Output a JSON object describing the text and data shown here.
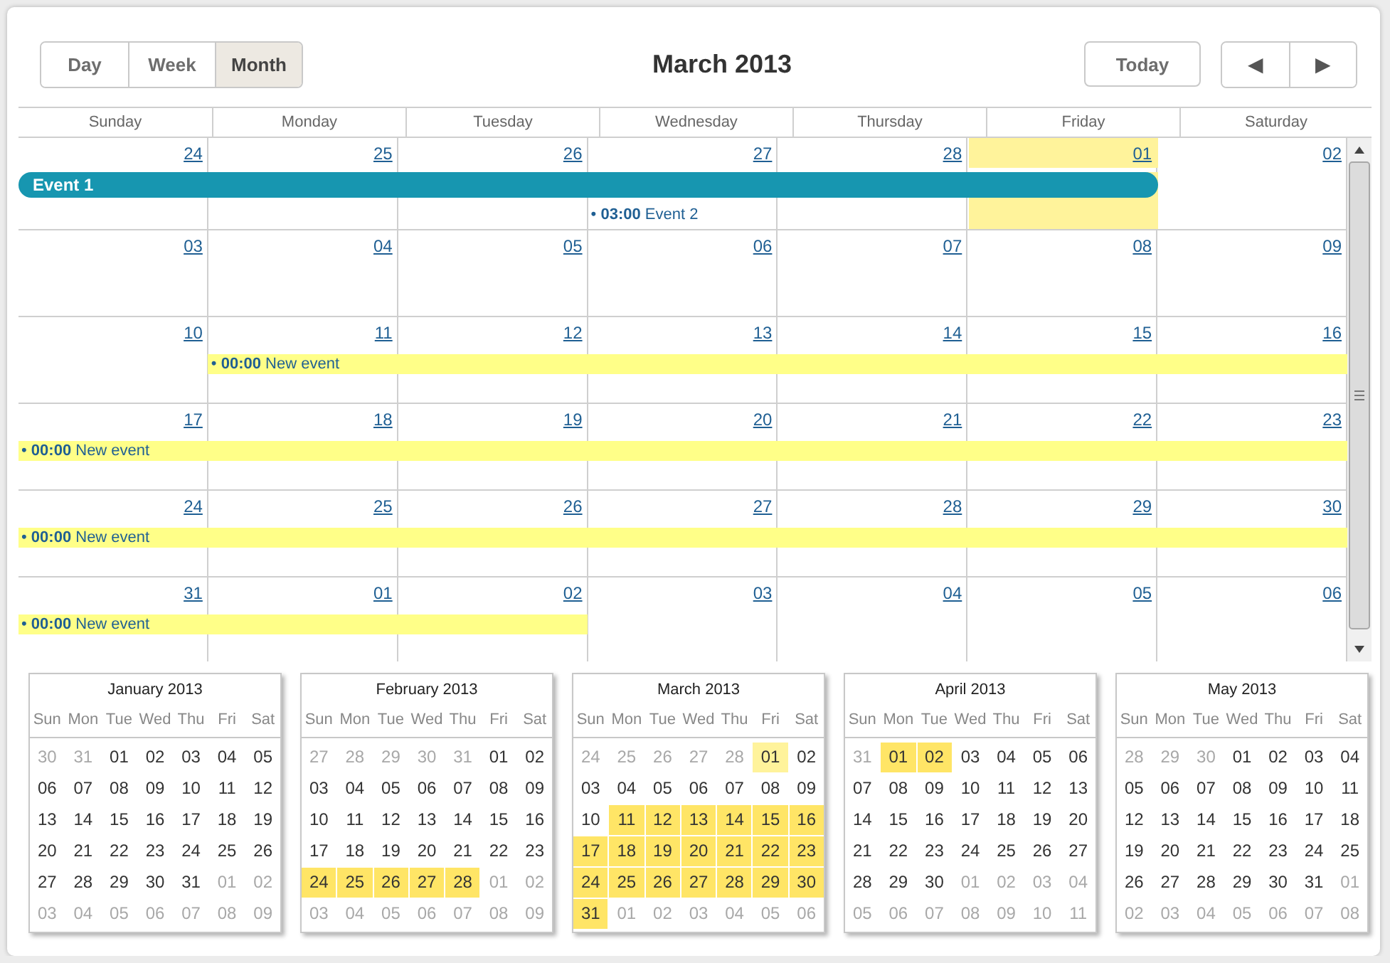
{
  "view_tabs": [
    {
      "label": "Day",
      "selected": false
    },
    {
      "label": "Week",
      "selected": false
    },
    {
      "label": "Month",
      "selected": true
    }
  ],
  "title": "March 2013",
  "today_button": "Today",
  "nav_buttons": [
    {
      "kind": "prev",
      "label": "◀"
    },
    {
      "kind": "next",
      "label": "▶"
    }
  ],
  "weekdays": [
    "Sunday",
    "Monday",
    "Tuesday",
    "Wednesday",
    "Thursday",
    "Friday",
    "Saturday"
  ],
  "weeks": [
    {
      "days": [
        {
          "label": "24",
          "today": false
        },
        {
          "label": "25",
          "today": false
        },
        {
          "label": "26",
          "today": false
        },
        {
          "label": "27",
          "today": false
        },
        {
          "label": "28",
          "today": false
        },
        {
          "label": "01",
          "today": true
        },
        {
          "label": "02",
          "today": false
        }
      ],
      "events": [
        {
          "kind": "bar",
          "title": "Event 1",
          "color": "#1796b0",
          "covers": [
            true,
            true,
            true,
            true,
            true,
            true,
            false
          ]
        },
        {
          "kind": "timed",
          "marker": "•",
          "time": "03:00",
          "title": "Event 2",
          "covers": [
            false,
            false,
            false,
            true,
            false,
            false,
            false
          ]
        }
      ]
    },
    {
      "days": [
        {
          "label": "03",
          "today": false
        },
        {
          "label": "04",
          "today": false
        },
        {
          "label": "05",
          "today": false
        },
        {
          "label": "06",
          "today": false
        },
        {
          "label": "07",
          "today": false
        },
        {
          "label": "08",
          "today": false
        },
        {
          "label": "09",
          "today": false
        }
      ]
    },
    {
      "days": [
        {
          "label": "10",
          "today": false
        },
        {
          "label": "11",
          "today": false
        },
        {
          "label": "12",
          "today": false
        },
        {
          "label": "13",
          "today": false
        },
        {
          "label": "14",
          "today": false
        },
        {
          "label": "15",
          "today": false
        },
        {
          "label": "16",
          "today": false
        }
      ],
      "events": [
        {
          "kind": "timed",
          "marker": "•",
          "time": "00:00",
          "title": "New event",
          "color": "#ffff88",
          "covers": [
            false,
            true,
            true,
            true,
            true,
            true,
            true
          ]
        }
      ]
    },
    {
      "days": [
        {
          "label": "17",
          "today": false
        },
        {
          "label": "18",
          "today": false
        },
        {
          "label": "19",
          "today": false
        },
        {
          "label": "20",
          "today": false
        },
        {
          "label": "21",
          "today": false
        },
        {
          "label": "22",
          "today": false
        },
        {
          "label": "23",
          "today": false
        }
      ],
      "events": [
        {
          "kind": "timed",
          "marker": "•",
          "time": "00:00",
          "title": "New event",
          "color": "#ffff88",
          "covers": [
            true,
            true,
            true,
            true,
            true,
            true,
            true
          ]
        }
      ]
    },
    {
      "days": [
        {
          "label": "24",
          "today": false
        },
        {
          "label": "25",
          "today": false
        },
        {
          "label": "26",
          "today": false
        },
        {
          "label": "27",
          "today": false
        },
        {
          "label": "28",
          "today": false
        },
        {
          "label": "29",
          "today": false
        },
        {
          "label": "30",
          "today": false
        }
      ],
      "events": [
        {
          "kind": "timed",
          "marker": "•",
          "time": "00:00",
          "title": "New event",
          "color": "#ffff88",
          "covers": [
            true,
            true,
            true,
            true,
            true,
            true,
            true
          ]
        }
      ]
    },
    {
      "days": [
        {
          "label": "31",
          "today": false
        },
        {
          "label": "01",
          "today": false
        },
        {
          "label": "02",
          "today": false
        },
        {
          "label": "03",
          "today": false
        },
        {
          "label": "04",
          "today": false
        },
        {
          "label": "05",
          "today": false
        },
        {
          "label": "06",
          "today": false
        }
      ],
      "events": [
        {
          "kind": "timed",
          "marker": "•",
          "time": "00:00",
          "title": "New event",
          "color": "#ffff88",
          "covers": [
            true,
            true,
            true,
            false,
            false,
            false,
            false
          ]
        }
      ]
    }
  ],
  "mini_calendars": [
    {
      "title": "January 2013",
      "weekdays": [
        "Sun",
        "Mon",
        "Tue",
        "Wed",
        "Thu",
        "Fri",
        "Sat"
      ],
      "weeks": [
        [
          {
            "label": "30",
            "outside": true,
            "has_event": false,
            "today": false
          },
          {
            "label": "31",
            "outside": true,
            "has_event": false,
            "today": false
          },
          {
            "label": "01",
            "outside": false,
            "has_event": false,
            "today": false
          },
          {
            "label": "02",
            "outside": false,
            "has_event": false,
            "today": false
          },
          {
            "label": "03",
            "outside": false,
            "has_event": false,
            "today": false
          },
          {
            "label": "04",
            "outside": false,
            "has_event": false,
            "today": false
          },
          {
            "label": "05",
            "outside": false,
            "has_event": false,
            "today": false
          }
        ],
        [
          {
            "label": "06",
            "outside": false,
            "has_event": false,
            "today": false
          },
          {
            "label": "07",
            "outside": false,
            "has_event": false,
            "today": false
          },
          {
            "label": "08",
            "outside": false,
            "has_event": false,
            "today": false
          },
          {
            "label": "09",
            "outside": false,
            "has_event": false,
            "today": false
          },
          {
            "label": "10",
            "outside": false,
            "has_event": false,
            "today": false
          },
          {
            "label": "11",
            "outside": false,
            "has_event": false,
            "today": false
          },
          {
            "label": "12",
            "outside": false,
            "has_event": false,
            "today": false
          }
        ],
        [
          {
            "label": "13",
            "outside": false,
            "has_event": false,
            "today": false
          },
          {
            "label": "14",
            "outside": false,
            "has_event": false,
            "today": false
          },
          {
            "label": "15",
            "outside": false,
            "has_event": false,
            "today": false
          },
          {
            "label": "16",
            "outside": false,
            "has_event": false,
            "today": false
          },
          {
            "label": "17",
            "outside": false,
            "has_event": false,
            "today": false
          },
          {
            "label": "18",
            "outside": false,
            "has_event": false,
            "today": false
          },
          {
            "label": "19",
            "outside": false,
            "has_event": false,
            "today": false
          }
        ],
        [
          {
            "label": "20",
            "outside": false,
            "has_event": false,
            "today": false
          },
          {
            "label": "21",
            "outside": false,
            "has_event": false,
            "today": false
          },
          {
            "label": "22",
            "outside": false,
            "has_event": false,
            "today": false
          },
          {
            "label": "23",
            "outside": false,
            "has_event": false,
            "today": false
          },
          {
            "label": "24",
            "outside": false,
            "has_event": false,
            "today": false
          },
          {
            "label": "25",
            "outside": false,
            "has_event": false,
            "today": false
          },
          {
            "label": "26",
            "outside": false,
            "has_event": false,
            "today": false
          }
        ],
        [
          {
            "label": "27",
            "outside": false,
            "has_event": false,
            "today": false
          },
          {
            "label": "28",
            "outside": false,
            "has_event": false,
            "today": false
          },
          {
            "label": "29",
            "outside": false,
            "has_event": false,
            "today": false
          },
          {
            "label": "30",
            "outside": false,
            "has_event": false,
            "today": false
          },
          {
            "label": "31",
            "outside": false,
            "has_event": false,
            "today": false
          },
          {
            "label": "01",
            "outside": true,
            "has_event": false,
            "today": false
          },
          {
            "label": "02",
            "outside": true,
            "has_event": false,
            "today": false
          }
        ],
        [
          {
            "label": "03",
            "outside": true,
            "has_event": false,
            "today": false
          },
          {
            "label": "04",
            "outside": true,
            "has_event": false,
            "today": false
          },
          {
            "label": "05",
            "outside": true,
            "has_event": false,
            "today": false
          },
          {
            "label": "06",
            "outside": true,
            "has_event": false,
            "today": false
          },
          {
            "label": "07",
            "outside": true,
            "has_event": false,
            "today": false
          },
          {
            "label": "08",
            "outside": true,
            "has_event": false,
            "today": false
          },
          {
            "label": "09",
            "outside": true,
            "has_event": false,
            "today": false
          }
        ]
      ]
    },
    {
      "title": "February 2013",
      "weekdays": [
        "Sun",
        "Mon",
        "Tue",
        "Wed",
        "Thu",
        "Fri",
        "Sat"
      ],
      "weeks": [
        [
          {
            "label": "27",
            "outside": true,
            "has_event": false,
            "today": false
          },
          {
            "label": "28",
            "outside": true,
            "has_event": false,
            "today": false
          },
          {
            "label": "29",
            "outside": true,
            "has_event": false,
            "today": false
          },
          {
            "label": "30",
            "outside": true,
            "has_event": false,
            "today": false
          },
          {
            "label": "31",
            "outside": true,
            "has_event": false,
            "today": false
          },
          {
            "label": "01",
            "outside": false,
            "has_event": false,
            "today": false
          },
          {
            "label": "02",
            "outside": false,
            "has_event": false,
            "today": false
          }
        ],
        [
          {
            "label": "03",
            "outside": false,
            "has_event": false,
            "today": false
          },
          {
            "label": "04",
            "outside": false,
            "has_event": false,
            "today": false
          },
          {
            "label": "05",
            "outside": false,
            "has_event": false,
            "today": false
          },
          {
            "label": "06",
            "outside": false,
            "has_event": false,
            "today": false
          },
          {
            "label": "07",
            "outside": false,
            "has_event": false,
            "today": false
          },
          {
            "label": "08",
            "outside": false,
            "has_event": false,
            "today": false
          },
          {
            "label": "09",
            "outside": false,
            "has_event": false,
            "today": false
          }
        ],
        [
          {
            "label": "10",
            "outside": false,
            "has_event": false,
            "today": false
          },
          {
            "label": "11",
            "outside": false,
            "has_event": false,
            "today": false
          },
          {
            "label": "12",
            "outside": false,
            "has_event": false,
            "today": false
          },
          {
            "label": "13",
            "outside": false,
            "has_event": false,
            "today": false
          },
          {
            "label": "14",
            "outside": false,
            "has_event": false,
            "today": false
          },
          {
            "label": "15",
            "outside": false,
            "has_event": false,
            "today": false
          },
          {
            "label": "16",
            "outside": false,
            "has_event": false,
            "today": false
          }
        ],
        [
          {
            "label": "17",
            "outside": false,
            "has_event": false,
            "today": false
          },
          {
            "label": "18",
            "outside": false,
            "has_event": false,
            "today": false
          },
          {
            "label": "19",
            "outside": false,
            "has_event": false,
            "today": false
          },
          {
            "label": "20",
            "outside": false,
            "has_event": false,
            "today": false
          },
          {
            "label": "21",
            "outside": false,
            "has_event": false,
            "today": false
          },
          {
            "label": "22",
            "outside": false,
            "has_event": false,
            "today": false
          },
          {
            "label": "23",
            "outside": false,
            "has_event": false,
            "today": false
          }
        ],
        [
          {
            "label": "24",
            "outside": false,
            "has_event": true,
            "today": false
          },
          {
            "label": "25",
            "outside": false,
            "has_event": true,
            "today": false
          },
          {
            "label": "26",
            "outside": false,
            "has_event": true,
            "today": false
          },
          {
            "label": "27",
            "outside": false,
            "has_event": true,
            "today": false
          },
          {
            "label": "28",
            "outside": false,
            "has_event": true,
            "today": false
          },
          {
            "label": "01",
            "outside": true,
            "has_event": false,
            "today": false
          },
          {
            "label": "02",
            "outside": true,
            "has_event": false,
            "today": false
          }
        ],
        [
          {
            "label": "03",
            "outside": true,
            "has_event": false,
            "today": false
          },
          {
            "label": "04",
            "outside": true,
            "has_event": false,
            "today": false
          },
          {
            "label": "05",
            "outside": true,
            "has_event": false,
            "today": false
          },
          {
            "label": "06",
            "outside": true,
            "has_event": false,
            "today": false
          },
          {
            "label": "07",
            "outside": true,
            "has_event": false,
            "today": false
          },
          {
            "label": "08",
            "outside": true,
            "has_event": false,
            "today": false
          },
          {
            "label": "09",
            "outside": true,
            "has_event": false,
            "today": false
          }
        ]
      ]
    },
    {
      "title": "March 2013",
      "weekdays": [
        "Sun",
        "Mon",
        "Tue",
        "Wed",
        "Thu",
        "Fri",
        "Sat"
      ],
      "weeks": [
        [
          {
            "label": "24",
            "outside": true,
            "has_event": false,
            "today": false
          },
          {
            "label": "25",
            "outside": true,
            "has_event": false,
            "today": false
          },
          {
            "label": "26",
            "outside": true,
            "has_event": false,
            "today": false
          },
          {
            "label": "27",
            "outside": true,
            "has_event": false,
            "today": false
          },
          {
            "label": "28",
            "outside": true,
            "has_event": false,
            "today": false
          },
          {
            "label": "01",
            "outside": false,
            "has_event": false,
            "today": true
          },
          {
            "label": "02",
            "outside": false,
            "has_event": false,
            "today": false
          }
        ],
        [
          {
            "label": "03",
            "outside": false,
            "has_event": false,
            "today": false
          },
          {
            "label": "04",
            "outside": false,
            "has_event": false,
            "today": false
          },
          {
            "label": "05",
            "outside": false,
            "has_event": false,
            "today": false
          },
          {
            "label": "06",
            "outside": false,
            "has_event": false,
            "today": false
          },
          {
            "label": "07",
            "outside": false,
            "has_event": false,
            "today": false
          },
          {
            "label": "08",
            "outside": false,
            "has_event": false,
            "today": false
          },
          {
            "label": "09",
            "outside": false,
            "has_event": false,
            "today": false
          }
        ],
        [
          {
            "label": "10",
            "outside": false,
            "has_event": false,
            "today": false
          },
          {
            "label": "11",
            "outside": false,
            "has_event": true,
            "today": false
          },
          {
            "label": "12",
            "outside": false,
            "has_event": true,
            "today": false
          },
          {
            "label": "13",
            "outside": false,
            "has_event": true,
            "today": false
          },
          {
            "label": "14",
            "outside": false,
            "has_event": true,
            "today": false
          },
          {
            "label": "15",
            "outside": false,
            "has_event": true,
            "today": false
          },
          {
            "label": "16",
            "outside": false,
            "has_event": true,
            "today": false
          }
        ],
        [
          {
            "label": "17",
            "outside": false,
            "has_event": true,
            "today": false
          },
          {
            "label": "18",
            "outside": false,
            "has_event": true,
            "today": false
          },
          {
            "label": "19",
            "outside": false,
            "has_event": true,
            "today": false
          },
          {
            "label": "20",
            "outside": false,
            "has_event": true,
            "today": false
          },
          {
            "label": "21",
            "outside": false,
            "has_event": true,
            "today": false
          },
          {
            "label": "22",
            "outside": false,
            "has_event": true,
            "today": false
          },
          {
            "label": "23",
            "outside": false,
            "has_event": true,
            "today": false
          }
        ],
        [
          {
            "label": "24",
            "outside": false,
            "has_event": true,
            "today": false
          },
          {
            "label": "25",
            "outside": false,
            "has_event": true,
            "today": false
          },
          {
            "label": "26",
            "outside": false,
            "has_event": true,
            "today": false
          },
          {
            "label": "27",
            "outside": false,
            "has_event": true,
            "today": false
          },
          {
            "label": "28",
            "outside": false,
            "has_event": true,
            "today": false
          },
          {
            "label": "29",
            "outside": false,
            "has_event": true,
            "today": false
          },
          {
            "label": "30",
            "outside": false,
            "has_event": true,
            "today": false
          }
        ],
        [
          {
            "label": "31",
            "outside": false,
            "has_event": true,
            "today": false
          },
          {
            "label": "01",
            "outside": true,
            "has_event": false,
            "today": false
          },
          {
            "label": "02",
            "outside": true,
            "has_event": false,
            "today": false
          },
          {
            "label": "03",
            "outside": true,
            "has_event": false,
            "today": false
          },
          {
            "label": "04",
            "outside": true,
            "has_event": false,
            "today": false
          },
          {
            "label": "05",
            "outside": true,
            "has_event": false,
            "today": false
          },
          {
            "label": "06",
            "outside": true,
            "has_event": false,
            "today": false
          }
        ]
      ]
    },
    {
      "title": "April 2013",
      "weekdays": [
        "Sun",
        "Mon",
        "Tue",
        "Wed",
        "Thu",
        "Fri",
        "Sat"
      ],
      "weeks": [
        [
          {
            "label": "31",
            "outside": true,
            "has_event": false,
            "today": false
          },
          {
            "label": "01",
            "outside": false,
            "has_event": true,
            "today": false
          },
          {
            "label": "02",
            "outside": false,
            "has_event": true,
            "today": false
          },
          {
            "label": "03",
            "outside": false,
            "has_event": false,
            "today": false
          },
          {
            "label": "04",
            "outside": false,
            "has_event": false,
            "today": false
          },
          {
            "label": "05",
            "outside": false,
            "has_event": false,
            "today": false
          },
          {
            "label": "06",
            "outside": false,
            "has_event": false,
            "today": false
          }
        ],
        [
          {
            "label": "07",
            "outside": false,
            "has_event": false,
            "today": false
          },
          {
            "label": "08",
            "outside": false,
            "has_event": false,
            "today": false
          },
          {
            "label": "09",
            "outside": false,
            "has_event": false,
            "today": false
          },
          {
            "label": "10",
            "outside": false,
            "has_event": false,
            "today": false
          },
          {
            "label": "11",
            "outside": false,
            "has_event": false,
            "today": false
          },
          {
            "label": "12",
            "outside": false,
            "has_event": false,
            "today": false
          },
          {
            "label": "13",
            "outside": false,
            "has_event": false,
            "today": false
          }
        ],
        [
          {
            "label": "14",
            "outside": false,
            "has_event": false,
            "today": false
          },
          {
            "label": "15",
            "outside": false,
            "has_event": false,
            "today": false
          },
          {
            "label": "16",
            "outside": false,
            "has_event": false,
            "today": false
          },
          {
            "label": "17",
            "outside": false,
            "has_event": false,
            "today": false
          },
          {
            "label": "18",
            "outside": false,
            "has_event": false,
            "today": false
          },
          {
            "label": "19",
            "outside": false,
            "has_event": false,
            "today": false
          },
          {
            "label": "20",
            "outside": false,
            "has_event": false,
            "today": false
          }
        ],
        [
          {
            "label": "21",
            "outside": false,
            "has_event": false,
            "today": false
          },
          {
            "label": "22",
            "outside": false,
            "has_event": false,
            "today": false
          },
          {
            "label": "23",
            "outside": false,
            "has_event": false,
            "today": false
          },
          {
            "label": "24",
            "outside": false,
            "has_event": false,
            "today": false
          },
          {
            "label": "25",
            "outside": false,
            "has_event": false,
            "today": false
          },
          {
            "label": "26",
            "outside": false,
            "has_event": false,
            "today": false
          },
          {
            "label": "27",
            "outside": false,
            "has_event": false,
            "today": false
          }
        ],
        [
          {
            "label": "28",
            "outside": false,
            "has_event": false,
            "today": false
          },
          {
            "label": "29",
            "outside": false,
            "has_event": false,
            "today": false
          },
          {
            "label": "30",
            "outside": false,
            "has_event": false,
            "today": false
          },
          {
            "label": "01",
            "outside": true,
            "has_event": false,
            "today": false
          },
          {
            "label": "02",
            "outside": true,
            "has_event": false,
            "today": false
          },
          {
            "label": "03",
            "outside": true,
            "has_event": false,
            "today": false
          },
          {
            "label": "04",
            "outside": true,
            "has_event": false,
            "today": false
          }
        ],
        [
          {
            "label": "05",
            "outside": true,
            "has_event": false,
            "today": false
          },
          {
            "label": "06",
            "outside": true,
            "has_event": false,
            "today": false
          },
          {
            "label": "07",
            "outside": true,
            "has_event": false,
            "today": false
          },
          {
            "label": "08",
            "outside": true,
            "has_event": false,
            "today": false
          },
          {
            "label": "09",
            "outside": true,
            "has_event": false,
            "today": false
          },
          {
            "label": "10",
            "outside": true,
            "has_event": false,
            "today": false
          },
          {
            "label": "11",
            "outside": true,
            "has_event": false,
            "today": false
          }
        ]
      ]
    },
    {
      "title": "May 2013",
      "weekdays": [
        "Sun",
        "Mon",
        "Tue",
        "Wed",
        "Thu",
        "Fri",
        "Sat"
      ],
      "weeks": [
        [
          {
            "label": "28",
            "outside": true,
            "has_event": false,
            "today": false
          },
          {
            "label": "29",
            "outside": true,
            "has_event": false,
            "today": false
          },
          {
            "label": "30",
            "outside": true,
            "has_event": false,
            "today": false
          },
          {
            "label": "01",
            "outside": false,
            "has_event": false,
            "today": false
          },
          {
            "label": "02",
            "outside": false,
            "has_event": false,
            "today": false
          },
          {
            "label": "03",
            "outside": false,
            "has_event": false,
            "today": false
          },
          {
            "label": "04",
            "outside": false,
            "has_event": false,
            "today": false
          }
        ],
        [
          {
            "label": "05",
            "outside": false,
            "has_event": false,
            "today": false
          },
          {
            "label": "06",
            "outside": false,
            "has_event": false,
            "today": false
          },
          {
            "label": "07",
            "outside": false,
            "has_event": false,
            "today": false
          },
          {
            "label": "08",
            "outside": false,
            "has_event": false,
            "today": false
          },
          {
            "label": "09",
            "outside": false,
            "has_event": false,
            "today": false
          },
          {
            "label": "10",
            "outside": false,
            "has_event": false,
            "today": false
          },
          {
            "label": "11",
            "outside": false,
            "has_event": false,
            "today": false
          }
        ],
        [
          {
            "label": "12",
            "outside": false,
            "has_event": false,
            "today": false
          },
          {
            "label": "13",
            "outside": false,
            "has_event": false,
            "today": false
          },
          {
            "label": "14",
            "outside": false,
            "has_event": false,
            "today": false
          },
          {
            "label": "15",
            "outside": false,
            "has_event": false,
            "today": false
          },
          {
            "label": "16",
            "outside": false,
            "has_event": false,
            "today": false
          },
          {
            "label": "17",
            "outside": false,
            "has_event": false,
            "today": false
          },
          {
            "label": "18",
            "outside": false,
            "has_event": false,
            "today": false
          }
        ],
        [
          {
            "label": "19",
            "outside": false,
            "has_event": false,
            "today": false
          },
          {
            "label": "20",
            "outside": false,
            "has_event": false,
            "today": false
          },
          {
            "label": "21",
            "outside": false,
            "has_event": false,
            "today": false
          },
          {
            "label": "22",
            "outside": false,
            "has_event": false,
            "today": false
          },
          {
            "label": "23",
            "outside": false,
            "has_event": false,
            "today": false
          },
          {
            "label": "24",
            "outside": false,
            "has_event": false,
            "today": false
          },
          {
            "label": "25",
            "outside": false,
            "has_event": false,
            "today": false
          }
        ],
        [
          {
            "label": "26",
            "outside": false,
            "has_event": false,
            "today": false
          },
          {
            "label": "27",
            "outside": false,
            "has_event": false,
            "today": false
          },
          {
            "label": "28",
            "outside": false,
            "has_event": false,
            "today": false
          },
          {
            "label": "29",
            "outside": false,
            "has_event": false,
            "today": false
          },
          {
            "label": "30",
            "outside": false,
            "has_event": false,
            "today": false
          },
          {
            "label": "31",
            "outside": false,
            "has_event": false,
            "today": false
          },
          {
            "label": "01",
            "outside": true,
            "has_event": false,
            "today": false
          }
        ],
        [
          {
            "label": "02",
            "outside": true,
            "has_event": false,
            "today": false
          },
          {
            "label": "03",
            "outside": true,
            "has_event": false,
            "today": false
          },
          {
            "label": "04",
            "outside": true,
            "has_event": false,
            "today": false
          },
          {
            "label": "05",
            "outside": true,
            "has_event": false,
            "today": false
          },
          {
            "label": "06",
            "outside": true,
            "has_event": false,
            "today": false
          },
          {
            "label": "07",
            "outside": true,
            "has_event": false,
            "today": false
          },
          {
            "label": "08",
            "outside": true,
            "has_event": false,
            "today": false
          }
        ]
      ]
    }
  ]
}
